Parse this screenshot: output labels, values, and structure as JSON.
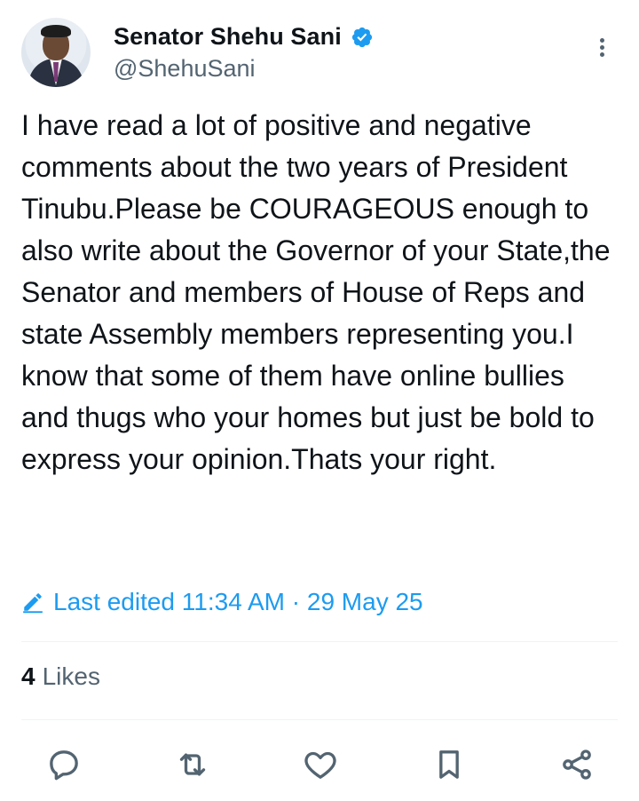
{
  "author": {
    "name": "Senator Shehu Sani",
    "handle": "@ShehuSani",
    "verified": true
  },
  "tweet": {
    "text": "I have read a lot of positive and negative comments about the two years of President Tinubu.Please be COURAGEOUS enough to also write about the Governor of your State,the Senator and members of House of Reps and state Assembly members representing you.I know that some of them have online bullies and thugs who your homes but just be bold to express your opinion.Thats your right.",
    "edited_label": "Last edited 11:34 AM · 29 May 25"
  },
  "metrics": {
    "likes_count": "4",
    "likes_label": "Likes"
  },
  "icons": {
    "reply": "reply-icon",
    "repost": "repost-icon",
    "like": "heart-icon",
    "bookmark": "bookmark-icon",
    "share": "share-icon",
    "more": "more-vertical-icon",
    "verified": "verified-badge-icon",
    "edit": "edit-icon"
  },
  "colors": {
    "text_primary": "#0f1419",
    "text_secondary": "#536471",
    "accent": "#1d9bf0",
    "divider": "#eff3f4"
  }
}
